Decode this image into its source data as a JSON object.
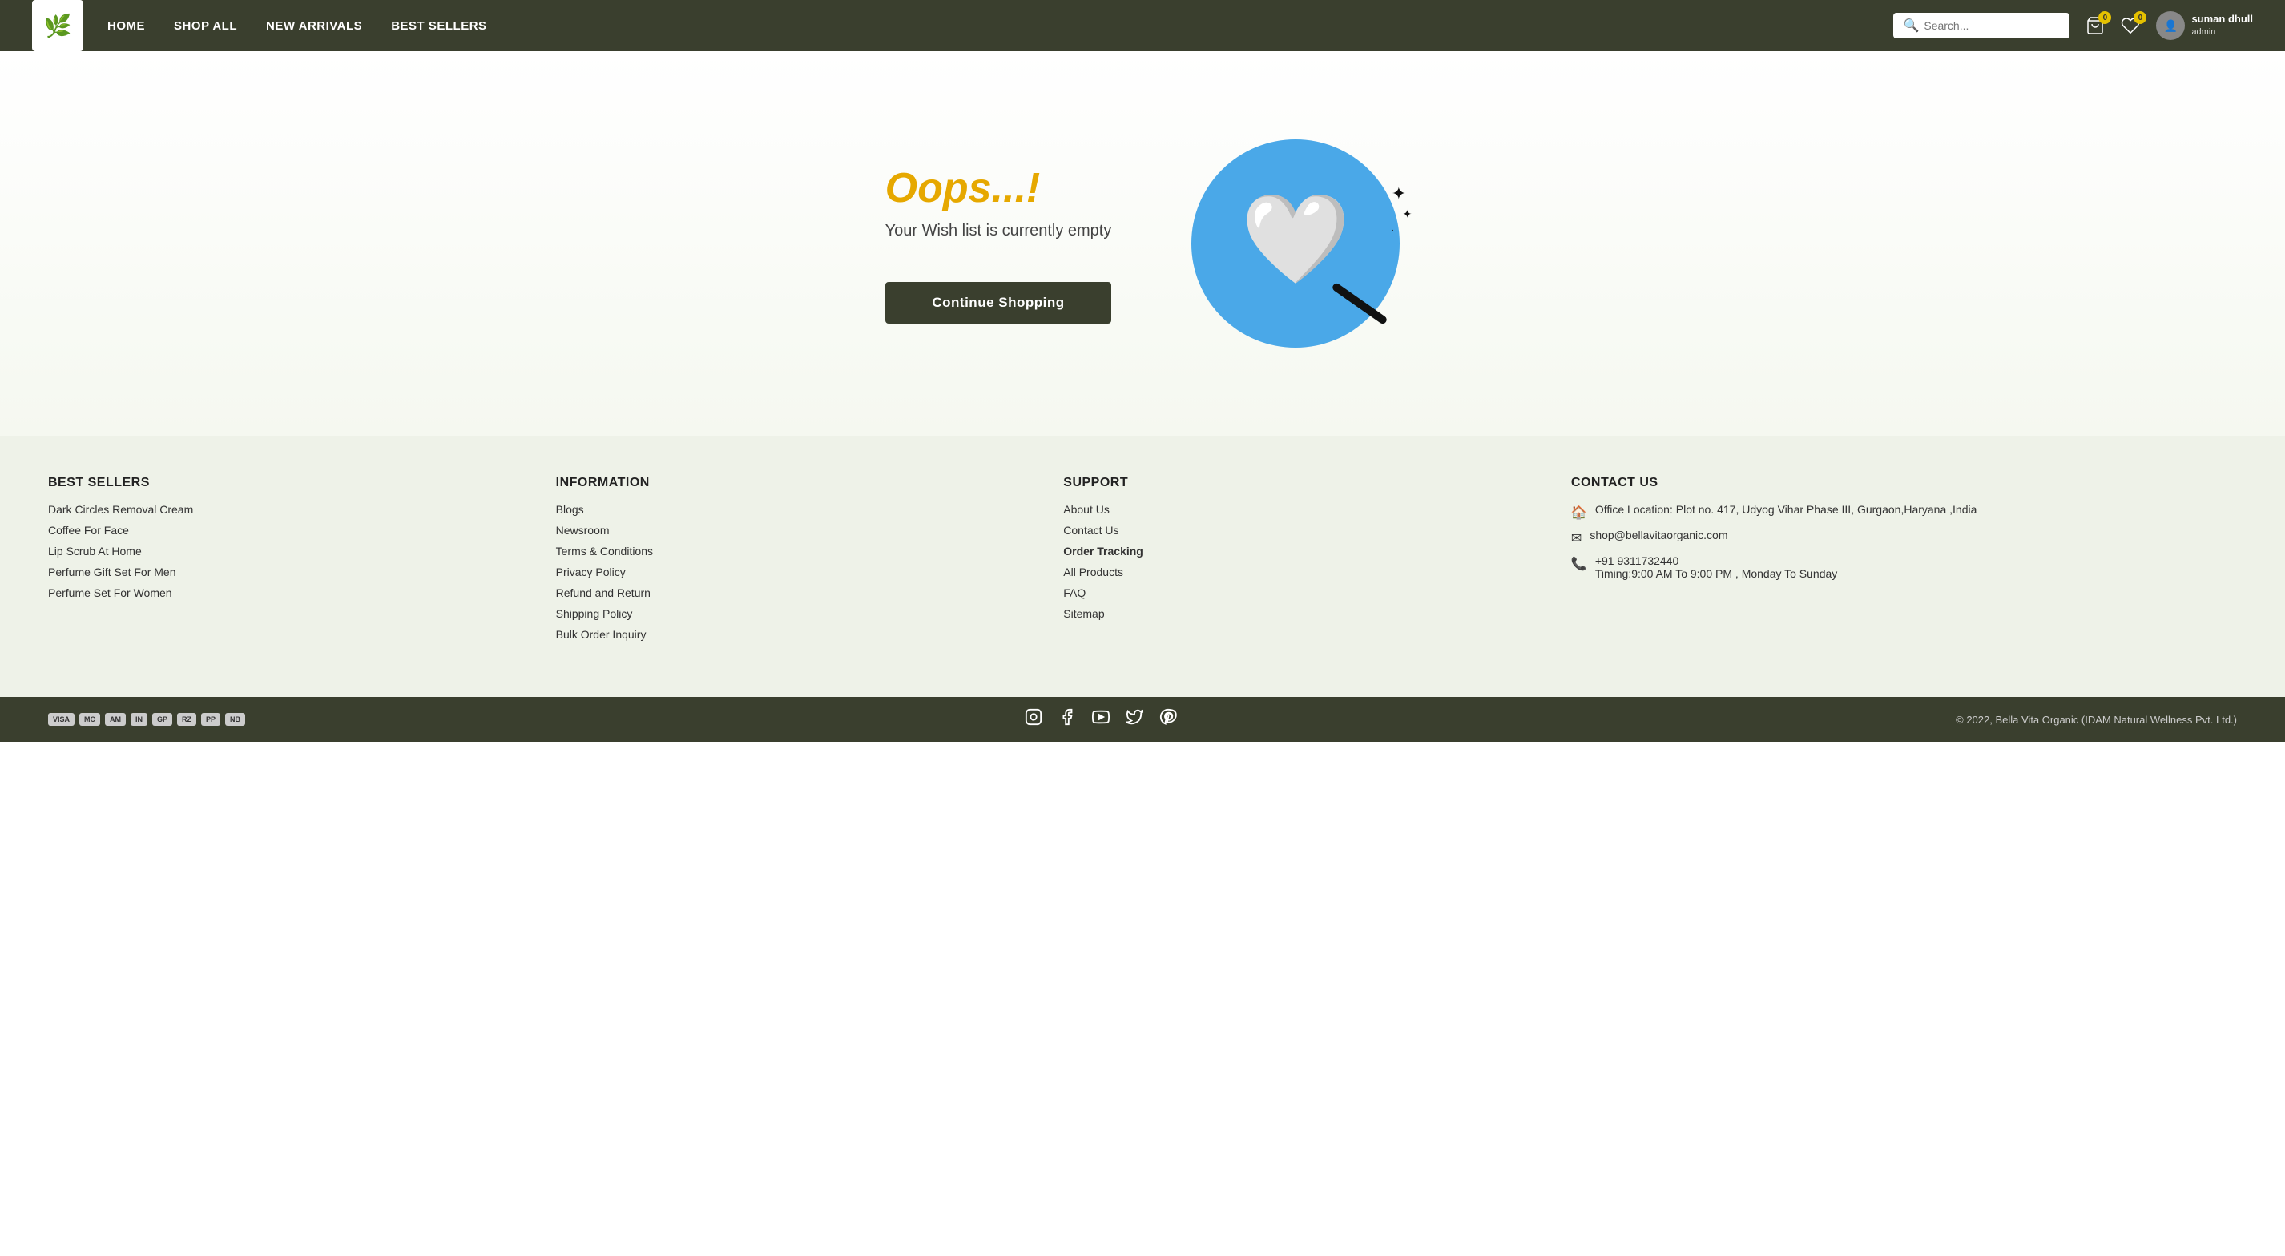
{
  "header": {
    "logo_icon": "🌿",
    "nav_items": [
      {
        "label": "HOME",
        "id": "home"
      },
      {
        "label": "SHOP ALL",
        "id": "shop-all"
      },
      {
        "label": "NEW ARRIVALS",
        "id": "new-arrivals"
      },
      {
        "label": "BEST SELLERS",
        "id": "best-sellers"
      }
    ],
    "search_placeholder": "Search...",
    "cart_count": "0",
    "wishlist_count": "0",
    "user_name": "suman dhull",
    "user_role": "admin"
  },
  "main": {
    "oops_title": "Oops...!",
    "empty_subtitle": "Your Wish list is currently empty",
    "continue_btn": "Continue Shopping"
  },
  "footer": {
    "best_sellers_title": "BEST SELLERS",
    "best_sellers_links": [
      "Dark Circles Removal Cream",
      "Coffee For Face",
      "Lip Scrub At Home",
      "Perfume Gift Set For Men",
      "Perfume Set For Women"
    ],
    "information_title": "INFORMATION",
    "information_links": [
      "Blogs",
      "Newsroom",
      "Terms & Conditions",
      "Privacy Policy",
      "Refund and Return",
      "Shipping Policy",
      "Bulk Order Inquiry"
    ],
    "support_title": "SUPPORT",
    "support_links": [
      {
        "label": "About Us",
        "bold": false
      },
      {
        "label": "Contact Us",
        "bold": false
      },
      {
        "label": "Order Tracking",
        "bold": true
      },
      {
        "label": "All Products",
        "bold": false
      },
      {
        "label": "FAQ",
        "bold": false
      },
      {
        "label": "Sitemap",
        "bold": false
      }
    ],
    "contact_title": "CONTACT US",
    "contact_office": "Office Location: Plot no. 417, Udyog Vihar Phase III, Gurgaon,Haryana ,India",
    "contact_email": "shop@bellavitaorganic.com",
    "contact_phone": "+91 9311732440",
    "contact_timing": "Timing:9:00 AM To 9:00 PM , Monday To Sunday",
    "copyright": "© 2022, Bella Vita Organic (IDAM Natural Wellness Pvt. Ltd.)",
    "payment_logos": [
      "VISA",
      "MC",
      "AM",
      "IN",
      "GP",
      "RZ",
      "PP",
      "NB"
    ]
  }
}
